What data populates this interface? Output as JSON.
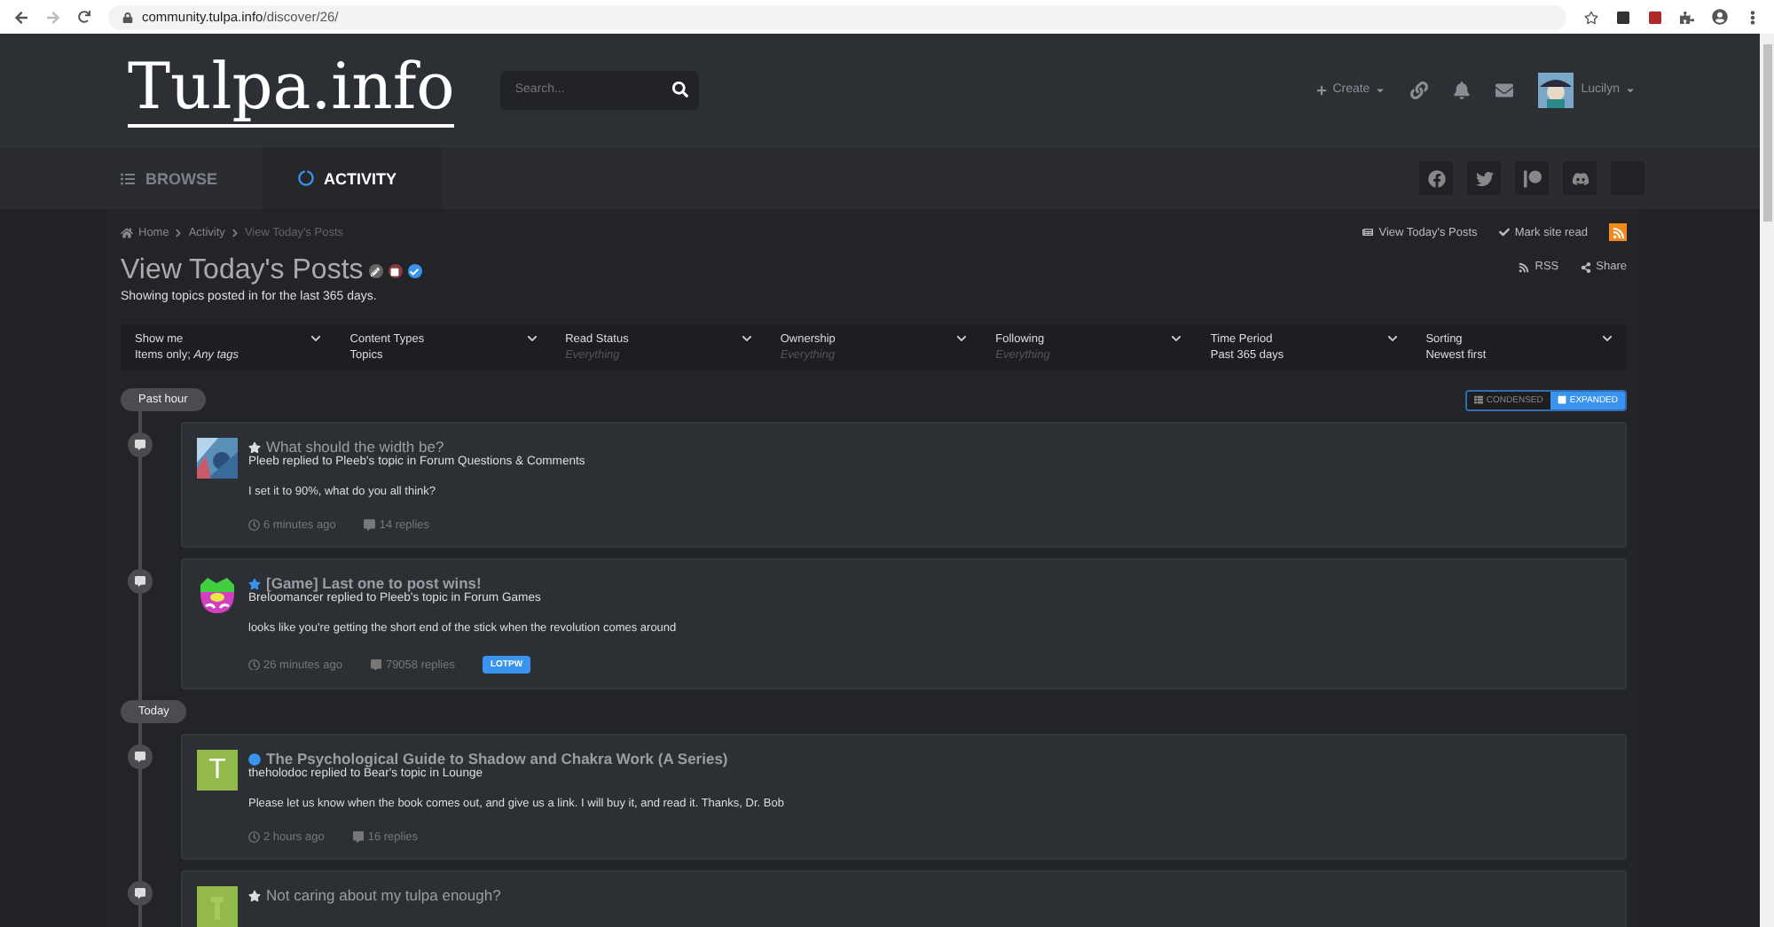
{
  "browser": {
    "url_host": "community.tulpa.info",
    "url_path": "/discover/26/"
  },
  "header": {
    "logo": "Tulpa.info",
    "search": {
      "placeholder": "Search..."
    },
    "create": "Create",
    "user": "Lucilyn"
  },
  "nav": {
    "tabs": [
      {
        "label": "BROWSE",
        "selected": false,
        "kind": "list"
      },
      {
        "label": "ACTIVITY",
        "selected": true,
        "kind": "activity"
      }
    ]
  },
  "breadcrumb": [
    "Home",
    "Activity",
    "View Today's Posts"
  ],
  "page_actions": [
    "View Today's Posts",
    "Mark site read"
  ],
  "page": {
    "title": "View Today's Posts",
    "subtitle": "Showing topics posted in for the last 365 days.",
    "rss": "RSS",
    "share": "Share"
  },
  "filters": [
    {
      "label": "Show me",
      "value": "Items only; *Any tags*",
      "muted": false
    },
    {
      "label": "Content Types",
      "value": "Topics",
      "muted": false
    },
    {
      "label": "Read Status",
      "value": "Everything",
      "muted": true
    },
    {
      "label": "Ownership",
      "value": "Everything",
      "muted": true
    },
    {
      "label": "Following",
      "value": "Everything",
      "muted": true
    },
    {
      "label": "Time Period",
      "value": "Past 365 days",
      "muted": false
    },
    {
      "label": "Sorting",
      "value": "Newest first",
      "muted": false
    }
  ],
  "view_toggle": [
    {
      "label": "CONDENSED",
      "selected": false
    },
    {
      "label": "EXPANDED",
      "selected": true
    }
  ],
  "groups": [
    {
      "label": "Past hour",
      "items": [
        {
          "kind": "star",
          "unread": false,
          "title": "What should the width be?",
          "byline": "Pleeb replied to Pleeb's topic in Forum Questions & Comments",
          "excerpt": "I set it to 90%, what do you all think?",
          "time": "6 minutes ago",
          "replies": "14 replies"
        },
        {
          "kind": "star",
          "unread": true,
          "title": "[Game] Last one to post wins!",
          "byline": "Breloomancer replied to Pleeb's topic in Forum Games",
          "excerpt": "looks like you're getting the short end of the stick when the revolution comes around",
          "time": "26 minutes ago",
          "replies": "79058 replies",
          "tags": [
            "LOTPW"
          ]
        }
      ]
    },
    {
      "label": "Today",
      "items": [
        {
          "kind": "dot",
          "unread": true,
          "avatar_letter": "T",
          "title": "The Psychological Guide to Shadow and Chakra Work (A Series)",
          "byline": "theholodoc replied to Bear's topic in Lounge",
          "excerpt": "Please let us know when the book comes out, and give us a link. I will buy it, and read it. Thanks, Dr. Bob",
          "time": "2 hours ago",
          "replies": "16 replies"
        },
        {
          "kind": "star",
          "unread": false,
          "title": "Not caring about my tulpa enough?"
        }
      ]
    }
  ]
}
